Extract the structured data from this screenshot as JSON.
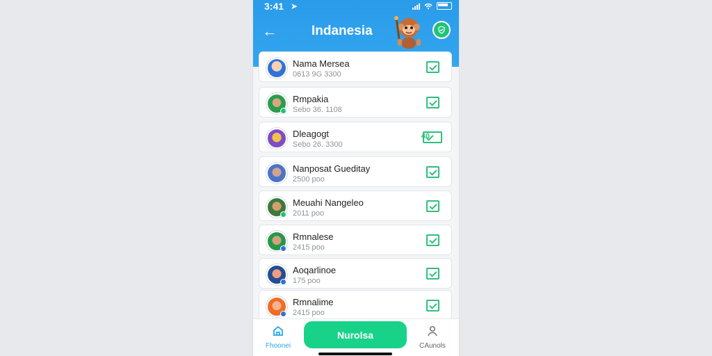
{
  "status_bar": {
    "time": "3:41"
  },
  "header": {
    "title": "Indanesia",
    "back_icon": "arrow-left-icon",
    "verify_icon": "shield-check-icon",
    "mascot_icon": "monkey-mascot-icon"
  },
  "list": [
    {
      "name": "Nama Mersea",
      "meta": "0613 9G 3300",
      "avatar_color": "#2f73d8",
      "badge_color": ""
    },
    {
      "name": "Rmpakia",
      "meta": "Sebo 36. 1108",
      "avatar_color": "#2b9d4d",
      "badge_color": "#22c373"
    },
    {
      "name": "Dleagogt",
      "meta": "Sebo 26. 3300",
      "avatar_color": "#7f4cc8",
      "badge_color": "",
      "check_label": "40"
    },
    {
      "name": "Nanposat Gueditay",
      "meta": "2500 poo",
      "avatar_color": "#4b74c7",
      "badge_color": ""
    },
    {
      "name": "Meuahi Nangeleo",
      "meta": "2011 poo",
      "avatar_color": "#3d7a3f",
      "badge_color": "#22c373"
    },
    {
      "name": "Rmnalese",
      "meta": "2415 poo",
      "avatar_color": "#27974b",
      "badge_color": "#2d73d9"
    },
    {
      "name": "Aoqarlinoe",
      "meta": "175 poo",
      "avatar_color": "#244e93",
      "badge_color": "#2d73d9"
    },
    {
      "name": "Rmnalime",
      "meta": "2415 poo",
      "avatar_color": "#f06c25",
      "badge_color": "#2d73d9"
    }
  ],
  "tabbar": {
    "home_label": "Fhoonei",
    "cta_label": "Nurolsa",
    "profile_label": "CAunols",
    "home_icon": "home-icon",
    "profile_icon": "user-icon"
  },
  "colors": {
    "header": "#2a9be9",
    "accent": "#19d28a",
    "check": "#2fbf7d"
  }
}
